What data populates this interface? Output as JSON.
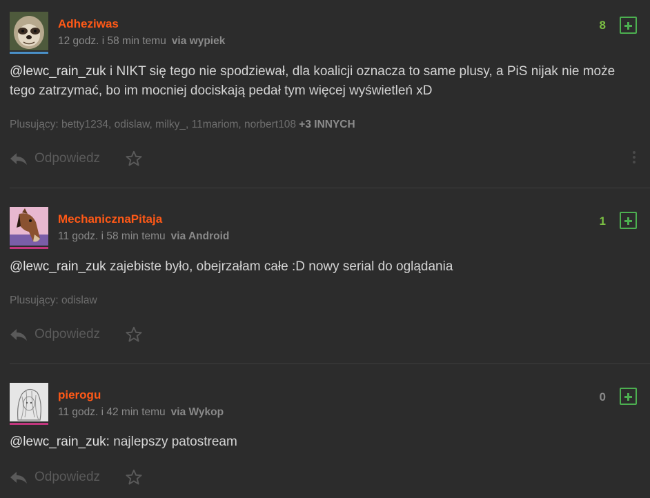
{
  "comments": [
    {
      "username": "Adheziwas",
      "time": "12 godz. i 58 min temu",
      "via": "via wypiek",
      "score": "8",
      "score_color": "#7bc043",
      "avatar_line_color": "#4a90c8",
      "mention": "@lewc_rain_zuk",
      "text": " i NIKT się tego nie spodziewał, dla koalicji oznacza to same plusy, a PiS nijak nie może tego zatrzymać, bo im mocniej dociskają pedał tym więcej wyświetleń xD",
      "voters": "Plusujący: betty1234,  odislaw,  milky_,  11mariom,  norbert108",
      "voters_more": "+3 INNYCH",
      "reply_label": "Odpowiedz"
    },
    {
      "username": "MechanicznaPitaja",
      "time": "11 godz. i 58 min temu",
      "via": "via Android",
      "score": "1",
      "score_color": "#7bc043",
      "avatar_line_color": "#c2367e",
      "mention": "@lewc_rain_zuk",
      "text": " zajebiste było, obejrzałam całe :D nowy serial do oglądania",
      "voters": "Plusujący: odislaw",
      "reply_label": "Odpowiedz"
    },
    {
      "username": "pierogu",
      "time": "11 godz. i 42 min temu",
      "via": "via Wykop",
      "score": "0",
      "score_color": "#8a8a8a",
      "avatar_line_color": "#c2367e",
      "mention": "@lewc_rain_zuk:",
      "text": " najlepszy patostream",
      "reply_label": "Odpowiedz"
    }
  ]
}
